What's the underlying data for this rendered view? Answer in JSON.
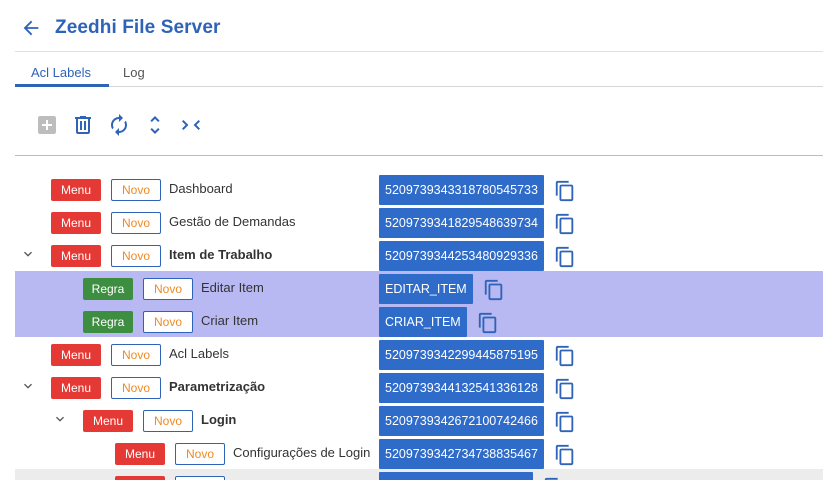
{
  "header": {
    "title": "Zeedhi File Server",
    "back_icon": "arrow-left-icon"
  },
  "tabs": [
    {
      "label": "Acl Labels",
      "active": true
    },
    {
      "label": "Log",
      "active": false
    }
  ],
  "toolbar": {
    "buttons": [
      {
        "icon": "add-box-icon",
        "disabled": true
      },
      {
        "icon": "trash-icon"
      },
      {
        "icon": "refresh-icon"
      },
      {
        "icon": "expand-all-icon"
      },
      {
        "icon": "collapse-all-icon"
      }
    ]
  },
  "tree": {
    "rows": [
      {
        "type": "Menu",
        "status": "Novo",
        "label": "Dashboard",
        "id": "520973934331878054573​3",
        "level": 0,
        "expanded": null,
        "bold": false,
        "highlight": false
      },
      {
        "type": "Menu",
        "status": "Novo",
        "label": "Gestão de Demandas",
        "id": "5209739341829548639734",
        "level": 0,
        "expanded": null,
        "bold": false,
        "highlight": false
      },
      {
        "type": "Menu",
        "status": "Novo",
        "label": "Item de Trabalho",
        "id": "5209739344253480929336",
        "level": 0,
        "expanded": true,
        "bold": true,
        "highlight": false
      },
      {
        "type": "Regra",
        "status": "Novo",
        "label": "Editar Item",
        "id": "EDITAR_ITEM",
        "level": 1,
        "expanded": null,
        "bold": false,
        "highlight": true
      },
      {
        "type": "Regra",
        "status": "Novo",
        "label": "Criar Item",
        "id": "CRIAR_ITEM",
        "level": 1,
        "expanded": null,
        "bold": false,
        "highlight": true
      },
      {
        "type": "Menu",
        "status": "Novo",
        "label": "Acl Labels",
        "id": "5209739342299445875195",
        "level": 0,
        "expanded": null,
        "bold": false,
        "highlight": false
      },
      {
        "type": "Menu",
        "status": "Novo",
        "label": "Parametrização",
        "id": "5209739344132541336128",
        "level": 0,
        "expanded": true,
        "bold": true,
        "highlight": false
      },
      {
        "type": "Menu",
        "status": "Novo",
        "label": "Login",
        "id": "5209739342672100742466",
        "level": 1,
        "expanded": true,
        "bold": true,
        "highlight": false
      },
      {
        "type": "Menu",
        "status": "Novo",
        "label": "Configurações de Login",
        "id": "5209739342734738835467",
        "level": 2,
        "expanded": null,
        "bold": false,
        "highlight": false
      },
      {
        "type": "Menu",
        "status": "Novo",
        "label": "",
        "id": "",
        "level": 2,
        "expanded": null,
        "bold": false,
        "highlight": false,
        "partial": true
      }
    ]
  },
  "colors": {
    "primary": "#2e63b8",
    "menu": "#e53935",
    "regra": "#3e8e41",
    "novo_text": "#f08a24",
    "highlight": "#b8b8f2",
    "id_box": "#2f6bc9"
  }
}
